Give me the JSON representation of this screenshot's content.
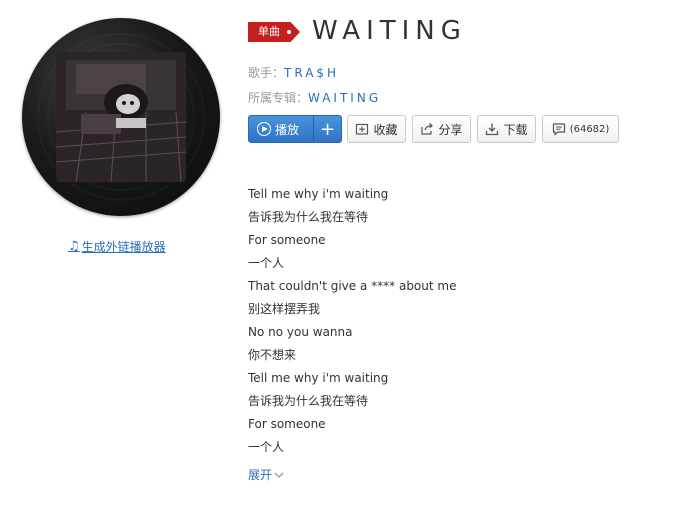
{
  "single_tag": "单曲",
  "song_title": "WAITING",
  "artist": {
    "label": "歌手：",
    "value": "TRA$H"
  },
  "album": {
    "label": "所属专辑：",
    "value": "WAITING"
  },
  "buttons": {
    "play": "播放",
    "collect": "收藏",
    "share": "分享",
    "download": "下载",
    "comment_count": "(64682)"
  },
  "external_player_link": "生成外链播放器",
  "lyrics": [
    "Tell me why i'm waiting",
    "告诉我为什么我在等待",
    "For someone",
    "一个人",
    "That couldn't give a **** about me",
    "别这样摆弄我",
    "No no you wanna",
    "你不想来",
    "Tell me why i'm waiting",
    "告诉我为什么我在等待",
    "For someone",
    "一个人"
  ],
  "expand_label": "展开",
  "colors": {
    "accent_blue": "#2a6db8",
    "tag_red": "#c4201f",
    "play_button": "#3a83d0"
  },
  "icons": {
    "play": "play-circle-icon",
    "add": "plus-icon",
    "collect": "folder-plus-icon",
    "share": "share-icon",
    "download": "download-icon",
    "comment": "comment-icon",
    "external": "music-note-icon",
    "expand": "chevron-down-icon"
  }
}
